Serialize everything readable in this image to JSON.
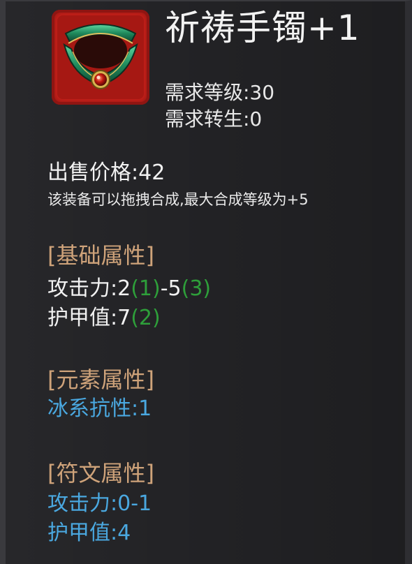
{
  "item": {
    "name": "祈祷手镯+1",
    "icon": "bracelet-icon",
    "name_color": "#d21f1a",
    "required_level": "需求等级:30",
    "required_rebirth": "需求转生:0",
    "sell_price": "出售价格:42",
    "merge_note": "该装备可以拖拽合成,最大合成等级为+5"
  },
  "sections": {
    "basic": {
      "header": "[基础属性]",
      "attack": {
        "label": "攻击力:2",
        "bonus_min": "(1)",
        "dash": "-5",
        "bonus_max": "(3)"
      },
      "armor": {
        "label": "护甲值:7",
        "bonus": "(2)"
      }
    },
    "element": {
      "header": "[元素属性]",
      "ice_resist": "冰系抗性:1"
    },
    "rune": {
      "header": "[符文属性]",
      "attack": "攻击力:0-1",
      "armor": "护甲值:4"
    }
  },
  "colors": {
    "header": "#cfa37a",
    "bonus_green": "#2e9f3a",
    "element_blue": "#4aa8e0",
    "frame_red": "#c8201a"
  }
}
